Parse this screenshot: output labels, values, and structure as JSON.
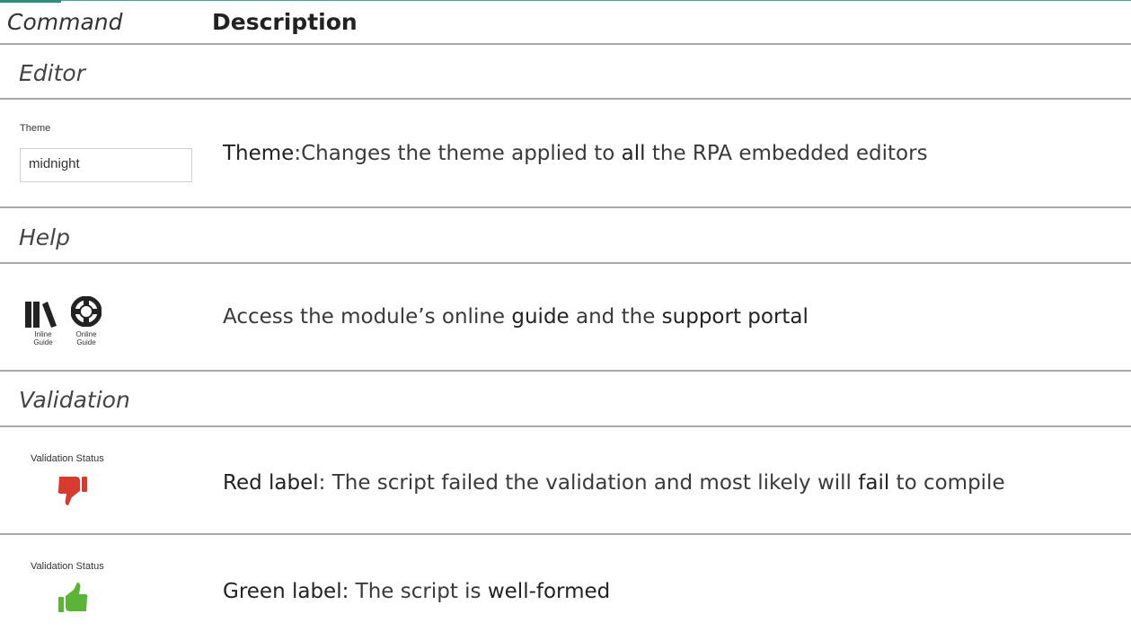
{
  "header": {
    "command": "Command",
    "description": "Description"
  },
  "sections": {
    "editor": "Editor",
    "help": "Help",
    "validation": "Validation"
  },
  "theme_row": {
    "control_label": "Theme",
    "input_value": "midnight",
    "desc_bold": "Theme",
    "desc_part1": ":Changes the theme applied to ",
    "desc_bold2": "all",
    "desc_part2": " the RPA embedded editors"
  },
  "help_row": {
    "inline_guide_label_1": "Inline",
    "inline_guide_label_2": "Guide",
    "online_guide_label_1": "Online",
    "online_guide_label_2": "Guide",
    "desc_part1": "Access the module’s online ",
    "desc_bold1": "guide",
    "desc_part2": " and the ",
    "desc_bold2": "support portal"
  },
  "validation_red_row": {
    "control_label": "Validation Status",
    "icon": "thumbs-down-icon",
    "icon_color": "#d63b2f",
    "desc_bold1": "Red label",
    "desc_part1": ": The script failed the validation and most likely will ",
    "desc_bold2": "fail",
    "desc_part2": " to compile"
  },
  "validation_green_row": {
    "control_label": "Validation Status",
    "icon": "thumbs-up-icon",
    "icon_color": "#5cb437",
    "desc_bold1": "Green label:",
    "desc_part1": " The script is ",
    "desc_bold2": "well-formed"
  }
}
